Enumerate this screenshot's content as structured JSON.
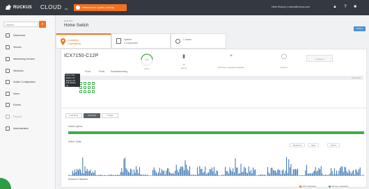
{
  "header": {
    "brand": "RUCKUS",
    "product": "CLOUD",
    "product_sub": "up",
    "alert_text": "Infrastructure update pending",
    "user_text": "Hello Ruckus | ruckus@ruckus.com",
    "icons": [
      "bell-icon",
      "help-icon",
      "user-icon"
    ],
    "accent_color": "#f37021"
  },
  "sidebar": {
    "search_placeholder": "Search",
    "items": [
      {
        "label": "Dashboard",
        "icon": "dashboard-icon"
      },
      {
        "label": "Venues",
        "icon": "location-icon"
      },
      {
        "label": "Networking Devices",
        "icon": "devices-icon"
      },
      {
        "label": "Networks",
        "icon": "networks-icon"
      },
      {
        "label": "Switch Configuration",
        "icon": "switch-config-icon"
      },
      {
        "label": "Users",
        "icon": "users-icon"
      },
      {
        "label": "Events",
        "icon": "events-icon"
      },
      {
        "label": "Reports",
        "icon": "reports-icon"
      },
      {
        "label": "Administration",
        "icon": "admin-icon"
      }
    ]
  },
  "main": {
    "breadcrumb": "Networks",
    "title": "Home Switch",
    "top_button": "Actions",
    "tabs": [
      {
        "line1": "Locations",
        "line2": "Operational"
      },
      {
        "line1": "Uptime",
        "line2": "4 Connected"
      },
      {
        "line1": "1 Users",
        "line2": ""
      }
    ]
  },
  "device": {
    "hostname": "ICX7150-C12P",
    "stats": [
      {
        "label": "Ports",
        "value": "12"
      },
      {
        "label": "Clients",
        "value": ""
      },
      {
        "label": "Firmware Upgrade Available",
        "value": "+"
      },
      {
        "label": "Reboot",
        "value": ""
      }
    ],
    "gauge_value": "1.0",
    "right_box": "Configure",
    "subtabs": [
      "Front",
      "Ports",
      "Troubleshooting"
    ],
    "port_bar_label": "Port View",
    "tooltip": [
      "Port: 1/1/4",
      "Status: Up",
      "Speed: 1G",
      "PoE Status: Up"
    ]
  },
  "traffic": {
    "ranges": [
      "Last Hour",
      "24 Hours",
      "7 Days"
    ],
    "active_range": 1,
    "uptime_label": "Switch Uptime",
    "traffic_label": "Switch Traffic",
    "legend_pills": [
      "Received",
      "Sent",
      "Errors"
    ],
    "bottom_section_label": "Resource Utilization",
    "legend_bottom": [
      "CPU Utilization",
      "Memory Utilization"
    ],
    "uptime_color": "#3fae49",
    "traffic_color": "#1a5fa8"
  }
}
